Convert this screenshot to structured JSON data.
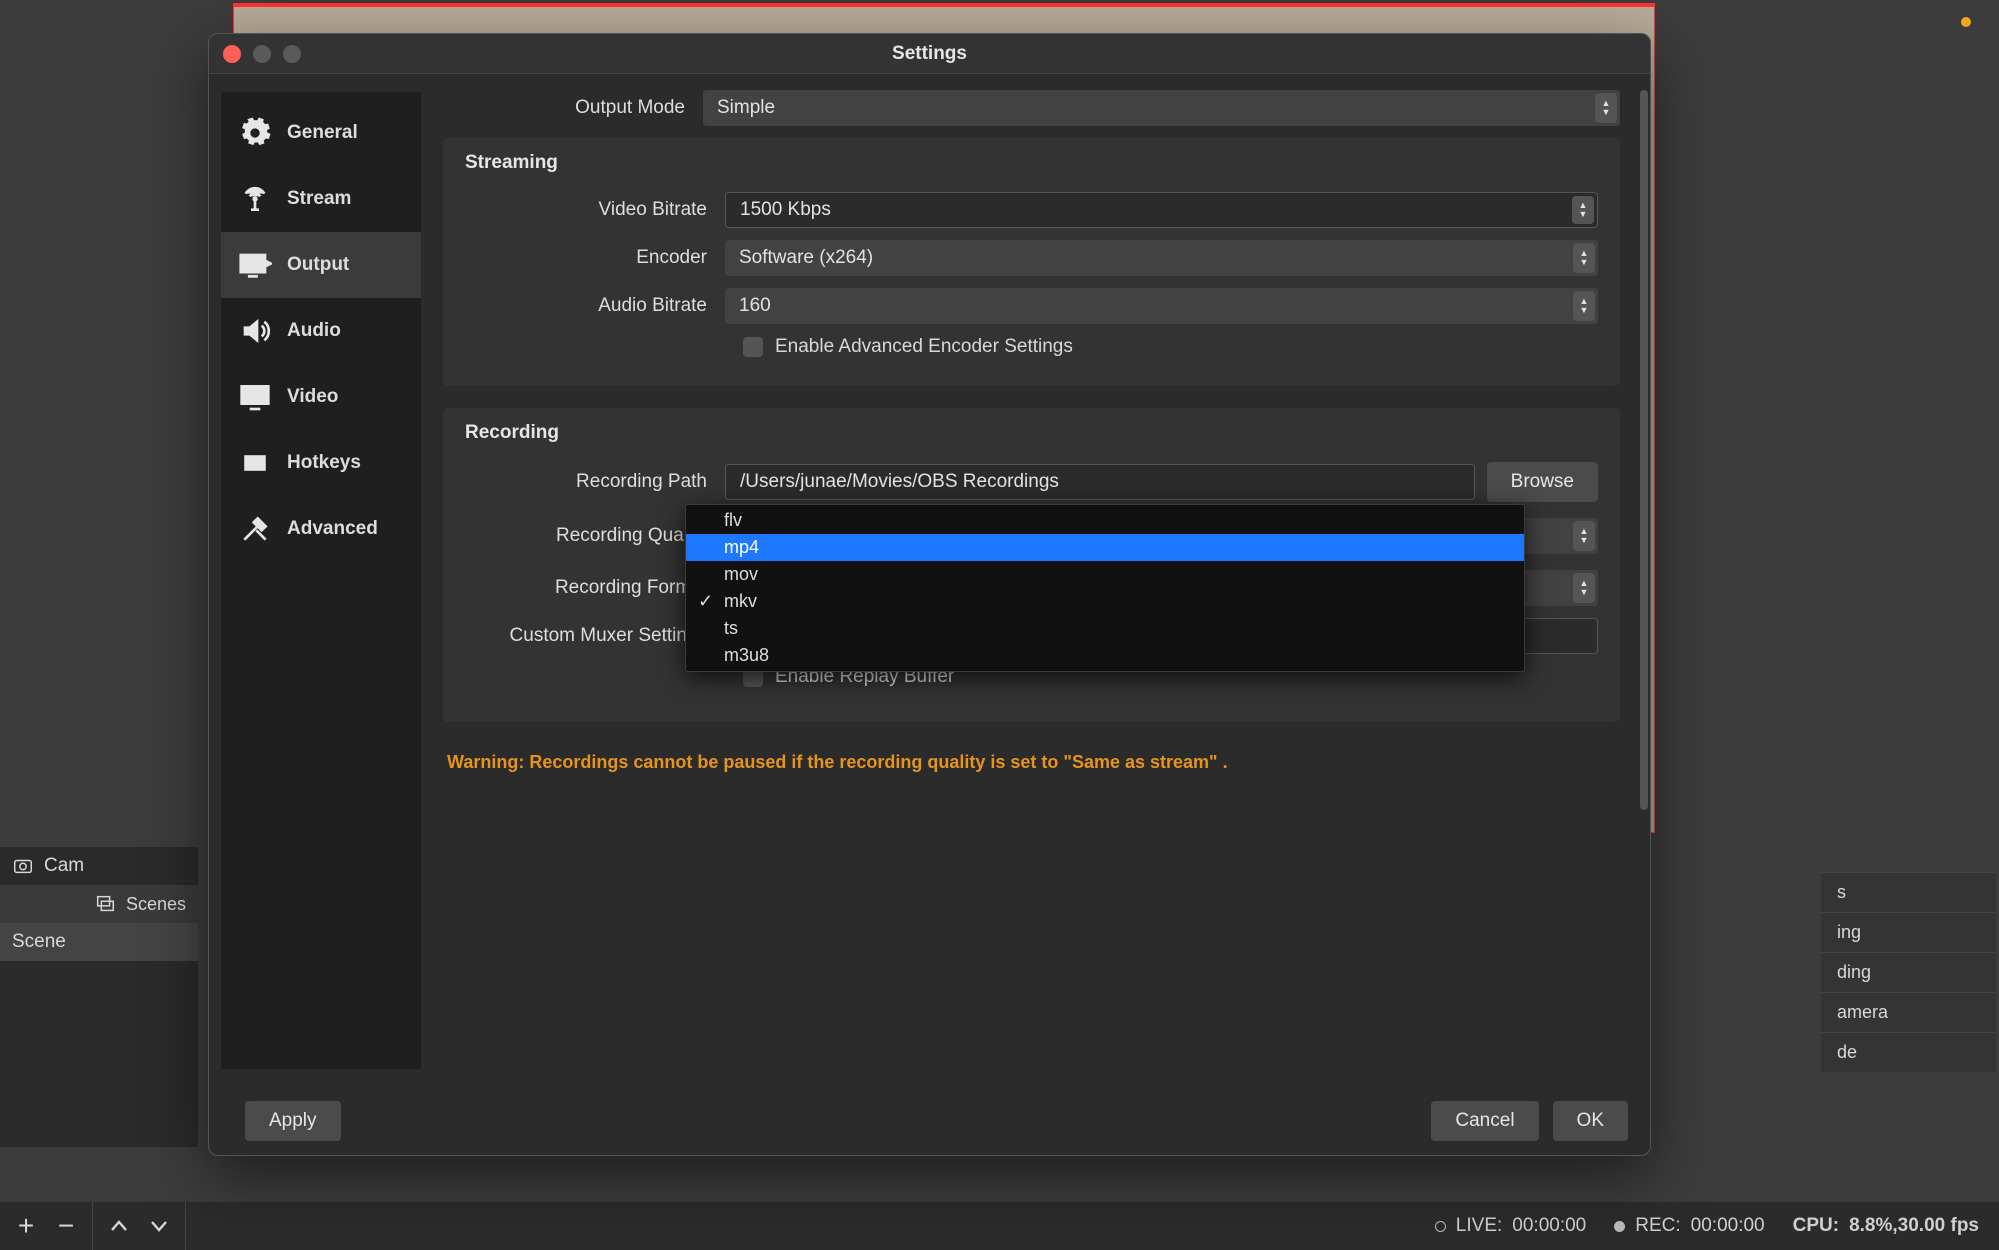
{
  "dialog": {
    "title": "Settings",
    "sidebar": [
      {
        "label": "General"
      },
      {
        "label": "Stream"
      },
      {
        "label": "Output"
      },
      {
        "label": "Audio"
      },
      {
        "label": "Video"
      },
      {
        "label": "Hotkeys"
      },
      {
        "label": "Advanced"
      }
    ],
    "output_mode": {
      "label": "Output Mode",
      "value": "Simple"
    },
    "streaming": {
      "heading": "Streaming",
      "video_bitrate": {
        "label": "Video Bitrate",
        "value": "1500 Kbps"
      },
      "encoder": {
        "label": "Encoder",
        "value": "Software (x264)"
      },
      "audio_bitrate": {
        "label": "Audio Bitrate",
        "value": "160"
      },
      "advanced_encoder": "Enable Advanced Encoder Settings"
    },
    "recording": {
      "heading": "Recording",
      "path": {
        "label": "Recording Path",
        "value": "/Users/junae/Movies/OBS Recordings",
        "browse": "Browse"
      },
      "quality": {
        "label": "Recording Quality"
      },
      "format": {
        "label": "Recording Format"
      },
      "muxer": {
        "label": "Custom Muxer Settings"
      },
      "replay": "Enable Replay Buffer",
      "format_options": [
        "flv",
        "mp4",
        "mov",
        "mkv",
        "ts",
        "m3u8"
      ],
      "hover_index": 1,
      "checked_index": 3
    },
    "warning": "Warning: Recordings cannot be paused if the recording quality is set to \"Same as stream\" .",
    "buttons": {
      "apply": "Apply",
      "cancel": "Cancel",
      "ok": "OK"
    }
  },
  "main": {
    "cam_label": "Cam",
    "scenes_header": "Scenes",
    "scene_row": "Scene",
    "controls": {
      "s": "s",
      "streaming": "ing",
      "recording": "ding",
      "camera": "amera",
      "mode": "de"
    },
    "status": {
      "live_label": "LIVE:",
      "live_time": "00:00:00",
      "rec_label": "REC:",
      "rec_time": "00:00:00",
      "cpu_label": "CPU:",
      "cpu_value": "8.8%,30.00 fps"
    }
  }
}
